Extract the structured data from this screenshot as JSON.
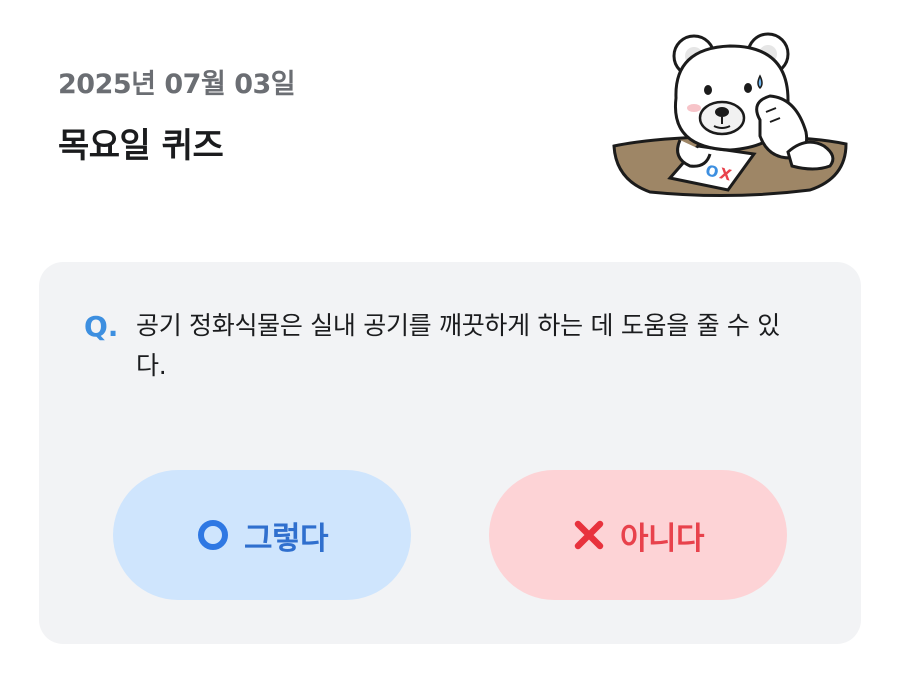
{
  "header": {
    "date": "2025년 07월 03일",
    "title": "목요일 퀴즈"
  },
  "mascot": {
    "icon": "polar-bear-mascot-icon",
    "paper_text": "OX"
  },
  "quiz": {
    "q_label": "Q.",
    "question": "공기 정화식물은 실내 공기를 깨끗하게 하는 데 도움을 줄 수 있다."
  },
  "answers": {
    "yes": {
      "label": "그렇다",
      "icon": "circle-o-icon",
      "color": "#2f6fce",
      "background": "#cfe5fd"
    },
    "no": {
      "label": "아니다",
      "icon": "x-mark-icon",
      "color": "#e8424c",
      "background": "#fdd3d6"
    }
  },
  "colors": {
    "accent_blue": "#3d8fe0",
    "card_background": "#f2f3f5",
    "date_text": "#6b6e73"
  }
}
